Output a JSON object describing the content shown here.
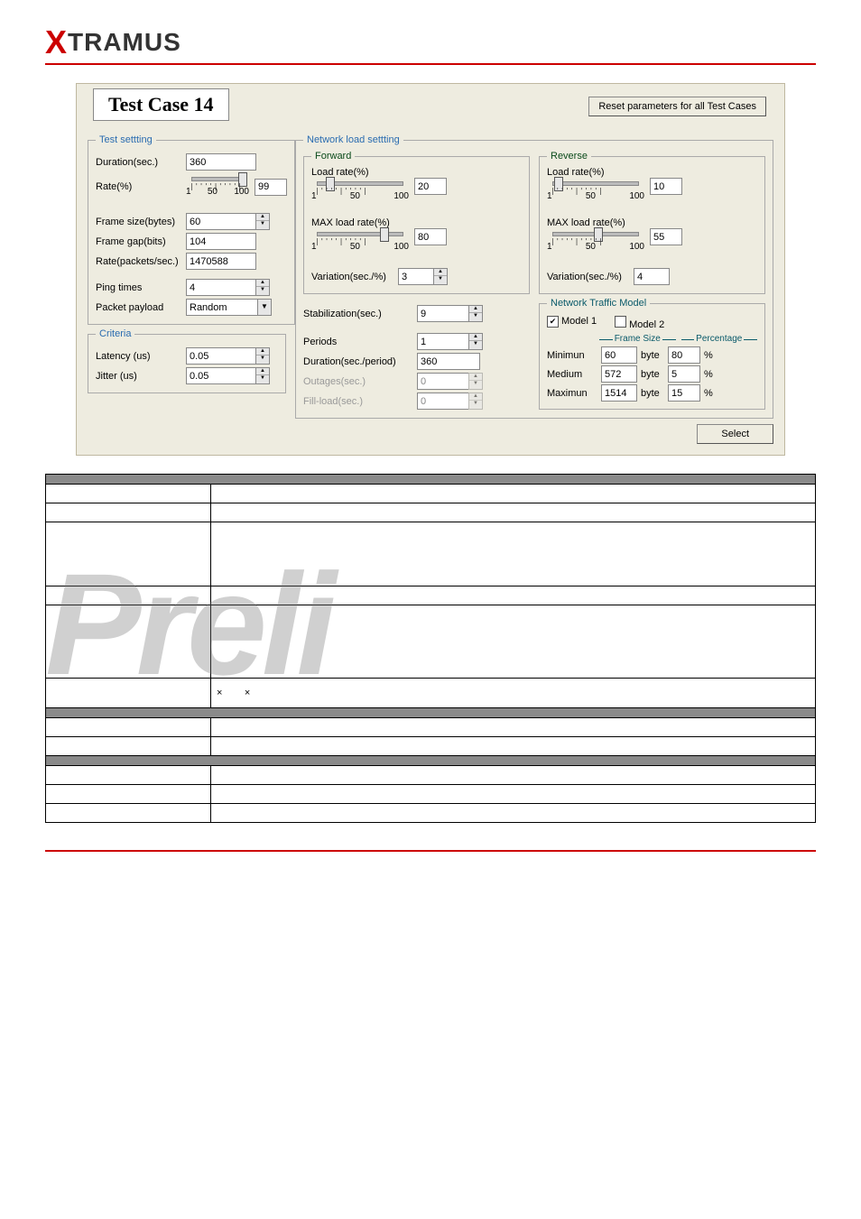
{
  "brand": {
    "x": "X",
    "rest": "TRAMUS"
  },
  "title": "Test Case 14",
  "resetBtn": "Reset parameters for all Test Cases",
  "selectBtn": "Select",
  "testSetting": {
    "legend": "Test settting",
    "duration": {
      "label": "Duration(sec.)",
      "value": "360"
    },
    "rate": {
      "label": "Rate(%)",
      "value": "99",
      "min": "1",
      "mid": "50",
      "max": "100"
    },
    "frameSize": {
      "label": "Frame size(bytes)",
      "value": "60"
    },
    "frameGap": {
      "label": "Frame gap(bits)",
      "value": "104"
    },
    "ratePkts": {
      "label": "Rate(packets/sec.)",
      "value": "1470588"
    },
    "pingTimes": {
      "label": "Ping times",
      "value": "4"
    },
    "payload": {
      "label": "Packet payload",
      "value": "Random"
    }
  },
  "criteria": {
    "legend": "Criteria",
    "latency": {
      "label": "Latency (us)",
      "value": "0.05"
    },
    "jitter": {
      "label": "Jitter (us)",
      "value": "0.05"
    }
  },
  "netLoad": {
    "legend": "Network load settting",
    "forward": {
      "legend": "Forward",
      "loadRate": {
        "label": "Load rate(%)",
        "value": "20",
        "min": "1",
        "mid": "50",
        "max": "100"
      },
      "maxLoad": {
        "label": "MAX load rate(%)",
        "value": "80",
        "min": "1",
        "mid": "50",
        "max": "100"
      },
      "variation": {
        "label": "Variation(sec./%)",
        "value": "3"
      }
    },
    "reverse": {
      "legend": "Reverse",
      "loadRate": {
        "label": "Load rate(%)",
        "value": "10",
        "min": "1",
        "mid": "50",
        "max": "100"
      },
      "maxLoad": {
        "label": "MAX load rate(%)",
        "value": "55",
        "min": "1",
        "mid": "50",
        "max": "100"
      },
      "variation": {
        "label": "Variation(sec./%)",
        "value": "4"
      }
    },
    "stabilization": {
      "label": "Stabilization(sec.)",
      "value": "9"
    },
    "periods": {
      "label": "Periods",
      "value": "1"
    },
    "durPerPeriod": {
      "label": "Duration(sec./period)",
      "value": "360"
    },
    "outages": {
      "label": "Outages(sec.)",
      "value": "0"
    },
    "fillLoad": {
      "label": "Fill-load(sec.)",
      "value": "0"
    }
  },
  "ntm": {
    "legend": "Network Traffic Model",
    "model1": "Model 1",
    "model2": "Model 2",
    "frameSize": "Frame Size",
    "percentage": "Percentage",
    "min": {
      "label": "Minimun",
      "size": "60",
      "pct": "80"
    },
    "med": {
      "label": "Medium",
      "size": "572",
      "pct": "5"
    },
    "max": {
      "label": "Maximun",
      "size": "1514",
      "pct": "15"
    },
    "byte": "byte",
    "pct": "%"
  },
  "watermark": "Preli",
  "x_sym": "×"
}
